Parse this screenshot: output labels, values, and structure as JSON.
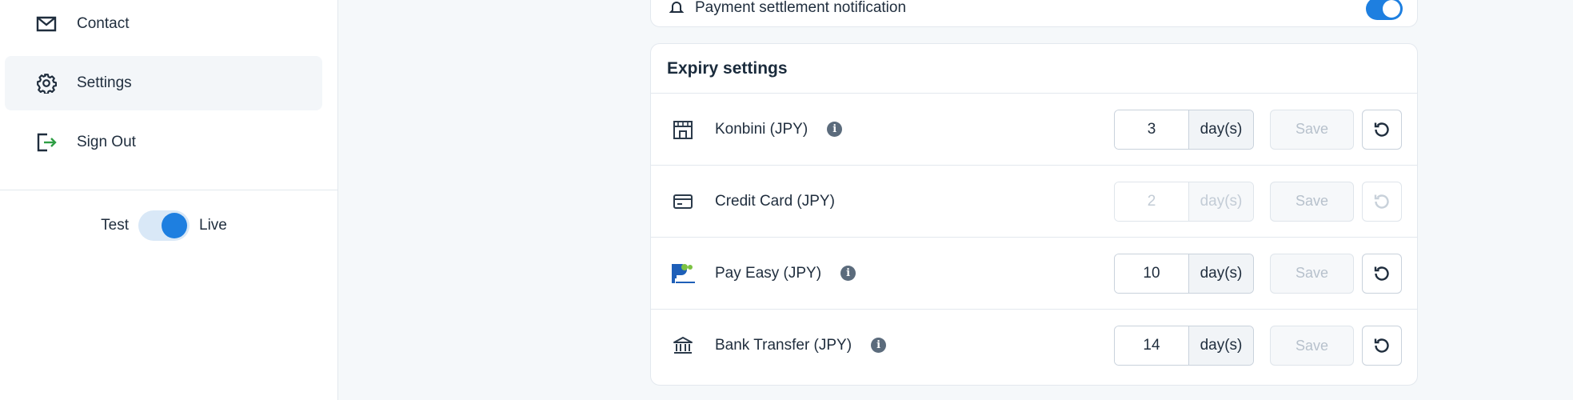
{
  "sidebar": {
    "items": [
      {
        "label": "Contact",
        "icon": "mail-icon"
      },
      {
        "label": "Settings",
        "icon": "gear-icon"
      },
      {
        "label": "Sign Out",
        "icon": "sign-out-icon"
      }
    ],
    "mode": {
      "left_label": "Test",
      "right_label": "Live",
      "value": "Live"
    }
  },
  "top_card": {
    "label": "Payment settlement notification",
    "toggle_on": true
  },
  "expiry": {
    "title": "Expiry settings",
    "rows": [
      {
        "label": "Konbini (JPY)",
        "value": "3",
        "unit": "day(s)",
        "save": "Save",
        "info": true,
        "disabled": false,
        "icon": "store-icon"
      },
      {
        "label": "Credit Card (JPY)",
        "value": "2",
        "unit": "day(s)",
        "save": "Save",
        "info": false,
        "disabled": true,
        "icon": "credit-card-icon"
      },
      {
        "label": "Pay Easy (JPY)",
        "value": "10",
        "unit": "day(s)",
        "save": "Save",
        "info": true,
        "disabled": false,
        "icon": "pay-easy-logo-icon"
      },
      {
        "label": "Bank Transfer (JPY)",
        "value": "14",
        "unit": "day(s)",
        "save": "Save",
        "info": true,
        "disabled": false,
        "icon": "bank-icon"
      }
    ]
  },
  "colors": {
    "accent": "#1e7fe0",
    "border": "#e3e8ee",
    "background": "#f5f8fa"
  }
}
